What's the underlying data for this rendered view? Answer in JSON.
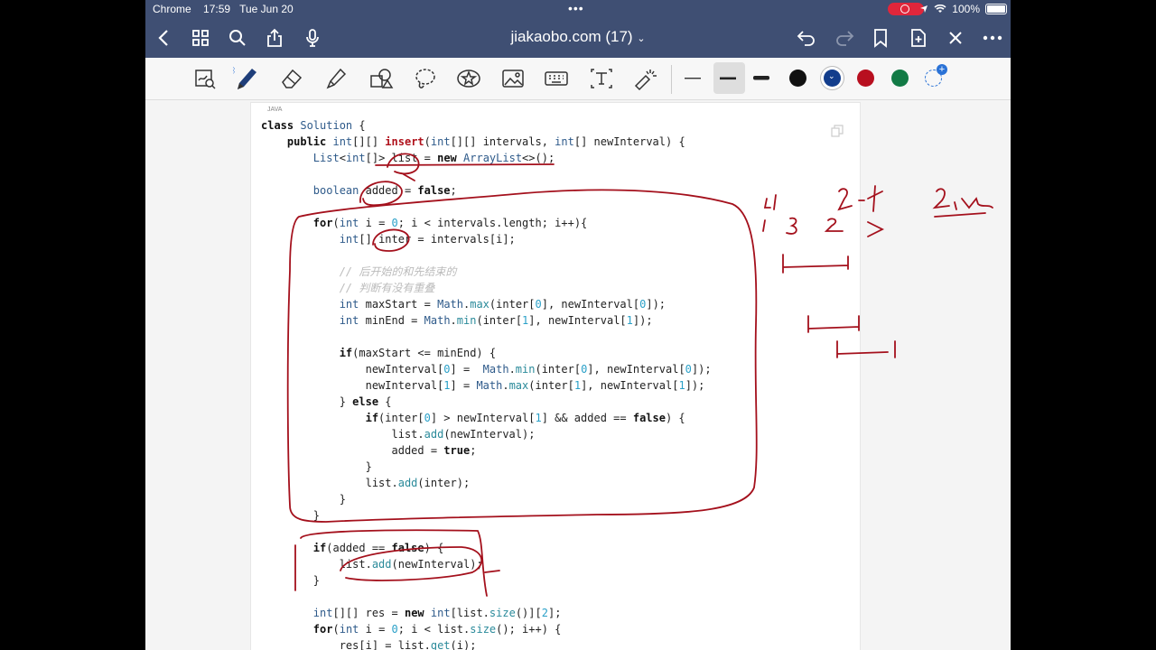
{
  "status_bar": {
    "app": "Chrome",
    "time": "17:59",
    "date": "Tue Jun 20",
    "battery": "100%"
  },
  "nav": {
    "title": "jiakaobo.com (17)"
  },
  "code_block": {
    "language": "JAVA",
    "lines": [
      [
        [
          "kw",
          "class "
        ],
        [
          "ty",
          "Solution"
        ],
        [
          "",
          " {"
        ]
      ],
      [
        [
          "",
          "    "
        ],
        [
          "kw",
          "public "
        ],
        [
          "ty",
          "int"
        ],
        [
          "",
          "[][] "
        ],
        [
          "red",
          "insert"
        ],
        [
          "",
          "("
        ],
        [
          "ty",
          "int"
        ],
        [
          "",
          "[][] intervals, "
        ],
        [
          "ty",
          "int"
        ],
        [
          "",
          "[] newInterval) {"
        ]
      ],
      [
        [
          "",
          "        "
        ],
        [
          "ty",
          "List"
        ],
        [
          "",
          "<"
        ],
        [
          "ty",
          "int"
        ],
        [
          "",
          "[]> list = "
        ],
        [
          "kw",
          "new "
        ],
        [
          "ty",
          "ArrayList"
        ],
        [
          "",
          "<>();"
        ]
      ],
      [
        [
          "",
          ""
        ]
      ],
      [
        [
          "",
          "        "
        ],
        [
          "ty",
          "boolean "
        ],
        [
          "",
          "added = "
        ],
        [
          "kw",
          "false"
        ],
        [
          "",
          ";"
        ]
      ],
      [
        [
          "",
          ""
        ]
      ],
      [
        [
          "",
          "        "
        ],
        [
          "kw",
          "for"
        ],
        [
          "",
          "("
        ],
        [
          "ty",
          "int "
        ],
        [
          "",
          "i = "
        ],
        [
          "num",
          "0"
        ],
        [
          "",
          "; i < intervals.length; i++){"
        ]
      ],
      [
        [
          "",
          "            "
        ],
        [
          "ty",
          "int"
        ],
        [
          "",
          "[] inter = intervals[i];"
        ]
      ],
      [
        [
          "",
          ""
        ]
      ],
      [
        [
          "cm",
          "            // 后开始的和先结束的"
        ]
      ],
      [
        [
          "cm",
          "            // 判断有没有重叠"
        ]
      ],
      [
        [
          "",
          "            "
        ],
        [
          "ty",
          "int "
        ],
        [
          "",
          "maxStart = "
        ],
        [
          "ty",
          "Math"
        ],
        [
          "",
          "."
        ],
        [
          "fn",
          "max"
        ],
        [
          "",
          "(inter["
        ],
        [
          "num",
          "0"
        ],
        [
          "",
          "], newInterval["
        ],
        [
          "num",
          "0"
        ],
        [
          "",
          "]);"
        ]
      ],
      [
        [
          "",
          "            "
        ],
        [
          "ty",
          "int "
        ],
        [
          "",
          "minEnd = "
        ],
        [
          "ty",
          "Math"
        ],
        [
          "",
          "."
        ],
        [
          "fn",
          "min"
        ],
        [
          "",
          "(inter["
        ],
        [
          "num",
          "1"
        ],
        [
          "",
          "], newInterval["
        ],
        [
          "num",
          "1"
        ],
        [
          "",
          "]);"
        ]
      ],
      [
        [
          "",
          ""
        ]
      ],
      [
        [
          "",
          "            "
        ],
        [
          "kw",
          "if"
        ],
        [
          "",
          "(maxStart <= minEnd) {"
        ]
      ],
      [
        [
          "",
          "                newInterval["
        ],
        [
          "num",
          "0"
        ],
        [
          "",
          "] =  "
        ],
        [
          "ty",
          "Math"
        ],
        [
          "",
          "."
        ],
        [
          "fn",
          "min"
        ],
        [
          "",
          "(inter["
        ],
        [
          "num",
          "0"
        ],
        [
          "",
          "], newInterval["
        ],
        [
          "num",
          "0"
        ],
        [
          "",
          "]);"
        ]
      ],
      [
        [
          "",
          "                newInterval["
        ],
        [
          "num",
          "1"
        ],
        [
          "",
          "] = "
        ],
        [
          "ty",
          "Math"
        ],
        [
          "",
          "."
        ],
        [
          "fn",
          "max"
        ],
        [
          "",
          "(inter["
        ],
        [
          "num",
          "1"
        ],
        [
          "",
          "], newInterval["
        ],
        [
          "num",
          "1"
        ],
        [
          "",
          "]);"
        ]
      ],
      [
        [
          "",
          "            } "
        ],
        [
          "kw",
          "else"
        ],
        [
          "",
          " {"
        ]
      ],
      [
        [
          "",
          "                "
        ],
        [
          "kw",
          "if"
        ],
        [
          "",
          "(inter["
        ],
        [
          "num",
          "0"
        ],
        [
          "",
          "] > newInterval["
        ],
        [
          "num",
          "1"
        ],
        [
          "",
          "] && added == "
        ],
        [
          "kw",
          "false"
        ],
        [
          "",
          ") {"
        ]
      ],
      [
        [
          "",
          "                    list."
        ],
        [
          "fn",
          "add"
        ],
        [
          "",
          "(newInterval);"
        ]
      ],
      [
        [
          "",
          "                    added = "
        ],
        [
          "kw",
          "true"
        ],
        [
          "",
          ";"
        ]
      ],
      [
        [
          "",
          "                }"
        ]
      ],
      [
        [
          "",
          "                list."
        ],
        [
          "fn",
          "add"
        ],
        [
          "",
          "(inter);"
        ]
      ],
      [
        [
          "",
          "            }"
        ]
      ],
      [
        [
          "",
          "        }"
        ]
      ],
      [
        [
          "",
          ""
        ]
      ],
      [
        [
          "",
          "        "
        ],
        [
          "kw",
          "if"
        ],
        [
          "",
          "(added == "
        ],
        [
          "kw",
          "false"
        ],
        [
          "",
          ") {"
        ]
      ],
      [
        [
          "",
          "            list."
        ],
        [
          "fn",
          "add"
        ],
        [
          "",
          "(newInterval);"
        ]
      ],
      [
        [
          "",
          "        }"
        ]
      ],
      [
        [
          "",
          ""
        ]
      ],
      [
        [
          "",
          "        "
        ],
        [
          "ty",
          "int"
        ],
        [
          "",
          "[][] res = "
        ],
        [
          "kw",
          "new "
        ],
        [
          "ty",
          "int"
        ],
        [
          "",
          "[list."
        ],
        [
          "fn",
          "size"
        ],
        [
          "",
          "()]["
        ],
        [
          "num",
          "2"
        ],
        [
          "",
          "];"
        ]
      ],
      [
        [
          "",
          "        "
        ],
        [
          "kw",
          "for"
        ],
        [
          "",
          "("
        ],
        [
          "ty",
          "int "
        ],
        [
          "",
          "i = "
        ],
        [
          "num",
          "0"
        ],
        [
          "",
          "; i < list."
        ],
        [
          "fn",
          "size"
        ],
        [
          "",
          "(); i++) {"
        ]
      ],
      [
        [
          "",
          "            res[i] = list."
        ],
        [
          "fn",
          "get"
        ],
        [
          "",
          "(i);"
        ]
      ]
    ]
  },
  "colors": {
    "bar": "#3f4f73",
    "ink": "#a4101c",
    "swatches": [
      "#111111",
      "#123d8c",
      "#b80f1f",
      "#127a45"
    ]
  },
  "tools": [
    "lasso-zoom-icon",
    "pen-icon",
    "eraser-icon",
    "highlighter-icon",
    "shapes-icon",
    "lasso-icon",
    "sticker-icon",
    "image-icon",
    "keyboard-icon",
    "text-icon",
    "laser-pointer-icon"
  ]
}
